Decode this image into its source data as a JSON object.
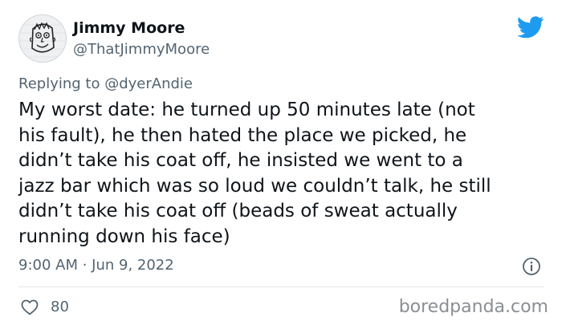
{
  "author": {
    "display_name": "Jimmy Moore",
    "handle": "@ThatJimmyMoore",
    "avatar_icon": "doodle-face-avatar"
  },
  "reply": {
    "prefix": "Replying to",
    "to_handle": "@dyerAndie"
  },
  "tweet": {
    "text": "My worst date: he turned up 50 minutes late (not\nhis fault), he then hated the place we picked, he\ndidn’t take his coat off, he insisted we went to a\njazz bar which was so loud we couldn’t talk, he still\ndidn’t take his coat off (beads of sweat actually\nrunning down his face)",
    "timestamp": "9:00 AM · Jun 9, 2022"
  },
  "actions": {
    "like_icon": "heart-icon",
    "like_count": "80",
    "info_icon": "info-icon"
  },
  "brand": {
    "logo_icon": "twitter-bird-icon",
    "logo_color": "#1d9bf0",
    "watermark": "boredpanda.com"
  },
  "colors": {
    "text_primary": "#0f1419",
    "text_secondary": "#536471"
  }
}
